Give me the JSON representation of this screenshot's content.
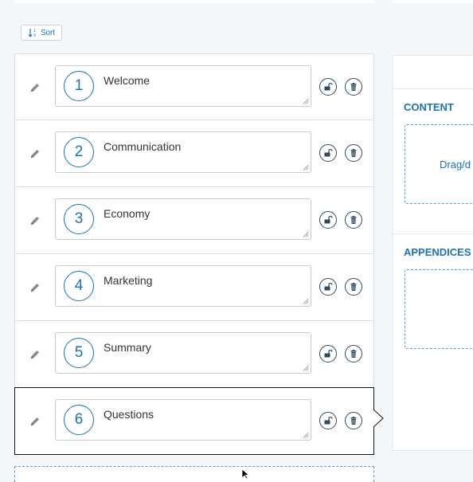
{
  "toolbar": {
    "sort_label": "Sort",
    "sort_icon": "sort-numeric-icon"
  },
  "chapters": [
    {
      "number": "1",
      "title": "Welcome",
      "selected": false
    },
    {
      "number": "2",
      "title": "Communication",
      "selected": false
    },
    {
      "number": "3",
      "title": "Economy",
      "selected": false
    },
    {
      "number": "4",
      "title": "Marketing",
      "selected": false
    },
    {
      "number": "5",
      "title": "Summary",
      "selected": false
    },
    {
      "number": "6",
      "title": "Questions",
      "selected": true
    }
  ],
  "right_panel": {
    "content_title": "CONTENT",
    "content_drop_text": "Drag/d",
    "appendices_title": "APPENDICES"
  },
  "colors": {
    "accent": "#1a73b8",
    "border": "#d9dfe5",
    "background": "#f4f7fa"
  }
}
